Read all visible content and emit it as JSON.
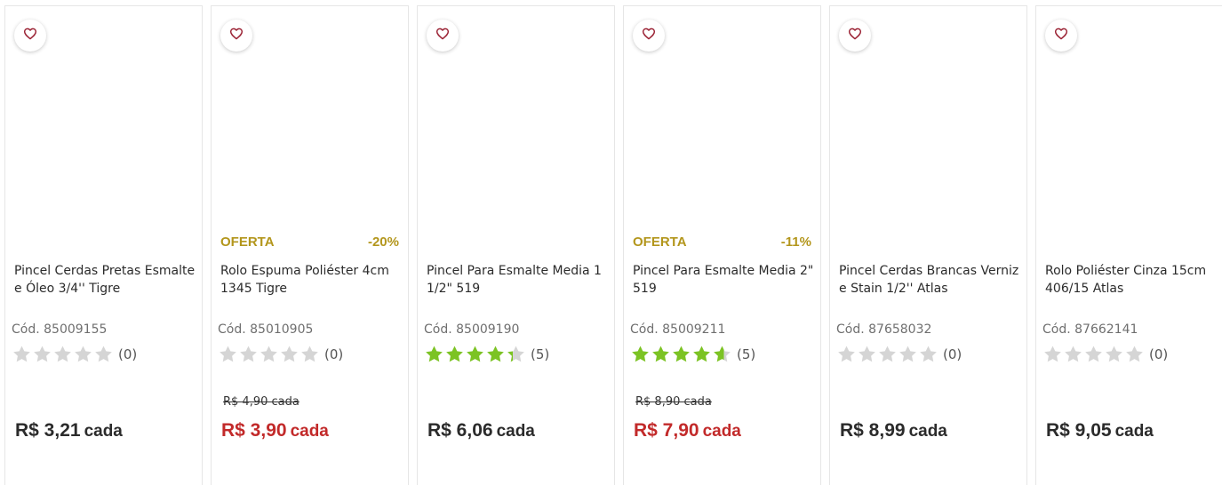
{
  "colors": {
    "offer": "#b3961c",
    "sale_price": "#c22a2a",
    "star_filled": "#7cc324",
    "star_empty": "#d5d5d5",
    "heart": "#9b2335"
  },
  "icons": {
    "favorite": "heart-outline-icon",
    "rating": "star-icon"
  },
  "products": [
    {
      "name": "Pincel Cerdas Pretas Esmalte e Óleo 3/4'' Tigre",
      "code": "Cód. 85009155",
      "rating": 0,
      "reviews": "(0)",
      "offer_label": "",
      "discount": "",
      "old_price": "",
      "price": "R$ 3,21",
      "unit": "cada",
      "on_sale": false
    },
    {
      "name": "Rolo Espuma Poliéster 4cm 1345 Tigre",
      "code": "Cód. 85010905",
      "rating": 0,
      "reviews": "(0)",
      "offer_label": "OFERTA",
      "discount": "-20%",
      "old_price": "R$ 4,90 cada",
      "price": "R$ 3,90",
      "unit": "cada",
      "on_sale": true
    },
    {
      "name": "Pincel Para Esmalte Media 1 1/2\" 519",
      "code": "Cód. 85009190",
      "rating": 4.3,
      "reviews": "(5)",
      "offer_label": "",
      "discount": "",
      "old_price": "",
      "price": "R$ 6,06",
      "unit": "cada",
      "on_sale": false
    },
    {
      "name": "Pincel Para Esmalte Media 2\" 519",
      "code": "Cód. 85009211",
      "rating": 4.6,
      "reviews": "(5)",
      "offer_label": "OFERTA",
      "discount": "-11%",
      "old_price": "R$ 8,90 cada",
      "price": "R$ 7,90",
      "unit": "cada",
      "on_sale": true
    },
    {
      "name": "Pincel Cerdas Brancas Verniz e Stain 1/2'' Atlas",
      "code": "Cód. 87658032",
      "rating": 0,
      "reviews": "(0)",
      "offer_label": "",
      "discount": "",
      "old_price": "",
      "price": "R$ 8,99",
      "unit": "cada",
      "on_sale": false
    },
    {
      "name": "Rolo Poliéster Cinza 15cm 406/15 Atlas",
      "code": "Cód. 87662141",
      "rating": 0,
      "reviews": "(0)",
      "offer_label": "",
      "discount": "",
      "old_price": "",
      "price": "R$ 9,05",
      "unit": "cada",
      "on_sale": false
    }
  ]
}
